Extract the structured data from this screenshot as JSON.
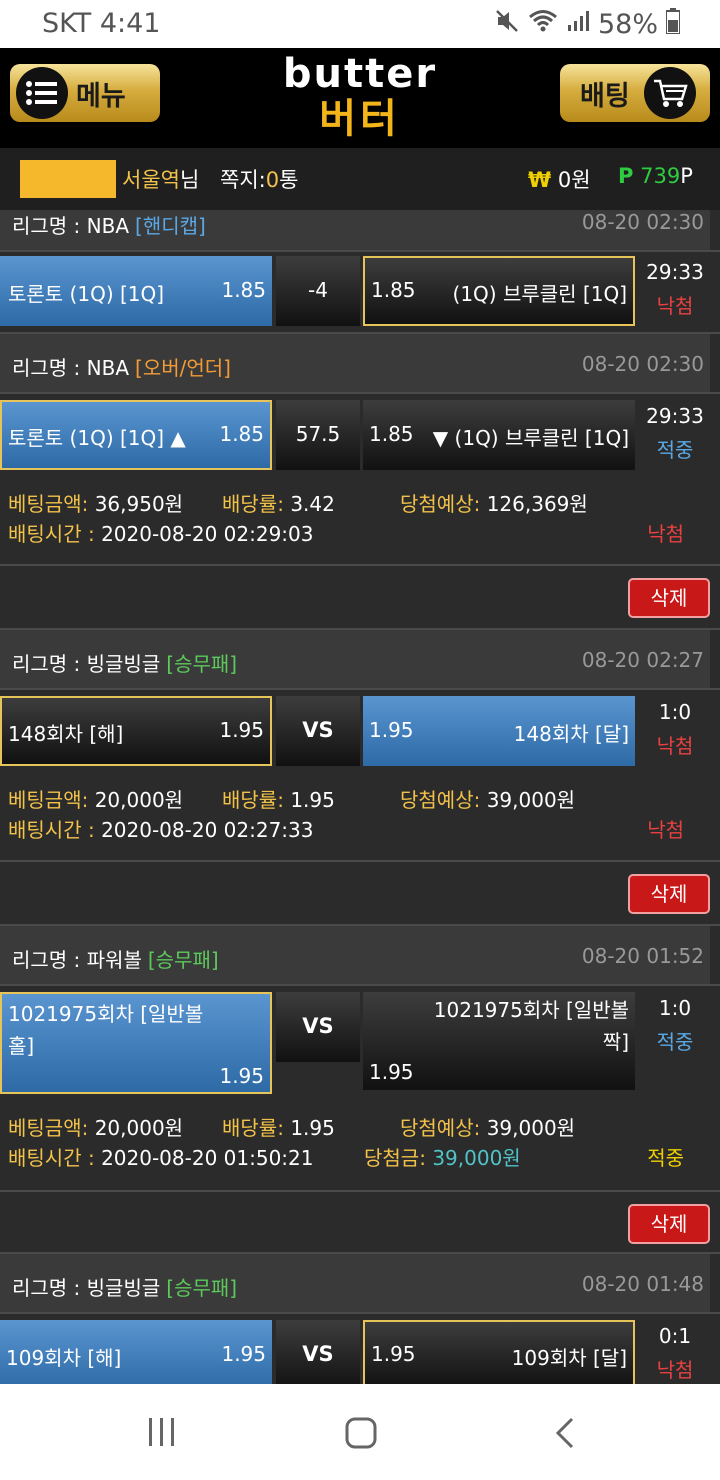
{
  "status_bar": {
    "carrier_time": "SKT 4:41",
    "battery": "58%"
  },
  "header": {
    "menu_label": "메뉴",
    "logo_en": "butter",
    "logo_ko": "버터",
    "bet_label": "배팅"
  },
  "user": {
    "name": "서울역",
    "name_suffix": "님",
    "msg_label": "쪽지:",
    "msg_count": "0",
    "msg_unit": "통",
    "won_symbol": "₩",
    "won_value": "0원",
    "points_symbol": "P",
    "points_value": "739",
    "points_unit": "P"
  },
  "labels": {
    "league_prefix": "리그명 : ",
    "bet_amount": "베팅금액:",
    "odds": "배당률:",
    "expected": "당첨예상:",
    "bet_time": "배팅시간 : ",
    "winnings": "당첨금:",
    "delete": "삭제"
  },
  "bets": [
    {
      "games": [
        {
          "league": "NBA",
          "type": "[핸디캡]",
          "date": "08-20 02:30",
          "left_team": "토론토 (1Q) [1Q]",
          "left_odds": "1.85",
          "mid": "-4",
          "right_odds": "1.85",
          "right_team": "(1Q) 브루클린 [1Q]",
          "score": "29:33",
          "result": "낙첨"
        },
        {
          "league": "NBA",
          "type": "[오버/언더]",
          "date": "08-20 02:30",
          "left_team": "토론토 (1Q) [1Q] ▲",
          "left_odds": "1.85",
          "mid": "57.5",
          "right_odds": "1.85",
          "right_team": "▼ (1Q) 브루클린 [1Q]",
          "score": "29:33",
          "result": "적중"
        }
      ],
      "amount": "36,950원",
      "odds": "3.42",
      "expected": "126,369원",
      "time": "2020-08-20 02:29:03",
      "status": "낙첨"
    },
    {
      "games": [
        {
          "league": "빙글빙글",
          "type": "[승무패]",
          "date": "08-20 02:27",
          "left_team": "148회차 [해]",
          "left_odds": "1.95",
          "mid": "VS",
          "right_odds": "1.95",
          "right_team": "148회차 [달]",
          "score": "1:0",
          "result": "낙첨"
        }
      ],
      "amount": "20,000원",
      "odds": "1.95",
      "expected": "39,000원",
      "time": "2020-08-20 02:27:33",
      "status": "낙첨"
    },
    {
      "games": [
        {
          "league": "파워볼",
          "type": "[승무패]",
          "date": "08-20 01:52",
          "left_team": "1021975회차 [일반볼 홀]",
          "left_odds": "1.95",
          "mid": "VS",
          "right_odds": "1.95",
          "right_team": "1021975회차 [일반볼 짝]",
          "score": "1:0",
          "result": "적중"
        }
      ],
      "amount": "20,000원",
      "odds": "1.95",
      "expected": "39,000원",
      "time": "2020-08-20 01:50:21",
      "winnings": "39,000원",
      "status": "적중"
    },
    {
      "games": [
        {
          "league": "빙글빙글",
          "type": "[승무패]",
          "date": "08-20 01:48",
          "left_team": "109회차 [해]",
          "left_odds": "1.95",
          "mid": "VS",
          "right_odds": "1.95",
          "right_team": "109회차 [달]",
          "score": "0:1",
          "result": "낙첨"
        }
      ]
    }
  ],
  "colors": {
    "gold": "#f2c24a",
    "blue_result": "#5aa9e6",
    "red_result": "#e84040",
    "win_yellow": "#f0d000",
    "points_green": "#2ecc40"
  }
}
